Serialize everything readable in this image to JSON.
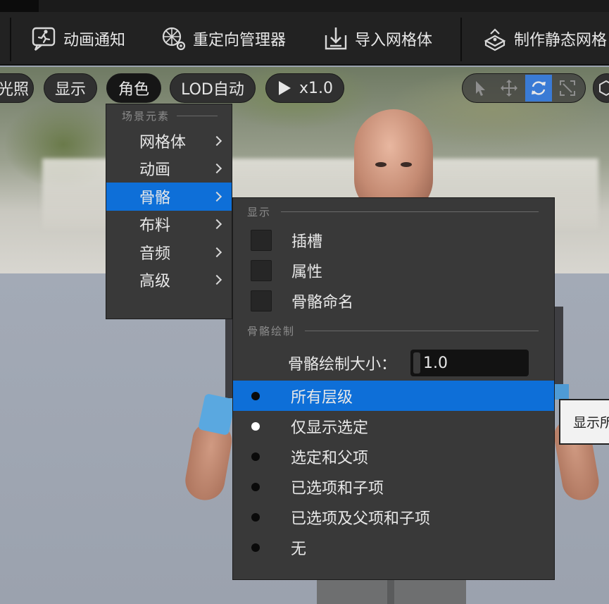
{
  "toolbar": {
    "items": [
      {
        "label": "动画通知",
        "icon": "anim-notify-icon"
      },
      {
        "label": "重定向管理器",
        "icon": "retarget-manager-icon"
      },
      {
        "label": "导入网格体",
        "icon": "import-mesh-icon"
      },
      {
        "label": "制作静态网格",
        "icon": "make-static-mesh-icon"
      }
    ]
  },
  "viewport_bar": {
    "lighting_partial": "光照",
    "show": "显示",
    "character": "角色",
    "lod": "LOD自动",
    "play_speed": "x1.0",
    "tools": [
      "select-arrow-icon",
      "move-icon",
      "rotate-icon",
      "scale-icon"
    ],
    "active_tool": "rotate-icon"
  },
  "character_menu": {
    "section": "场景元素",
    "items": [
      "网格体",
      "动画",
      "骨骼",
      "布料",
      "音频",
      "高级"
    ],
    "selected": "骨骼"
  },
  "skeleton_submenu": {
    "display_section": "显示",
    "checkboxes": [
      {
        "label": "插槽",
        "checked": false
      },
      {
        "label": "属性",
        "checked": false
      },
      {
        "label": "骨骼命名",
        "checked": false
      }
    ],
    "draw_section": "骨骼绘制",
    "draw_size_label": "骨骼绘制大小：",
    "draw_size_value": "1.0",
    "options": [
      "所有层级",
      "仅显示选定",
      "选定和父项",
      "已选项和子项",
      "已选项及父项和子项",
      "无"
    ],
    "highlighted": "所有层级",
    "selected": "仅显示选定"
  },
  "tooltip": "显示所",
  "colors": {
    "highlight": "#0e6fd8",
    "menu_bg": "#393939",
    "toolbar_bg": "#222222"
  }
}
